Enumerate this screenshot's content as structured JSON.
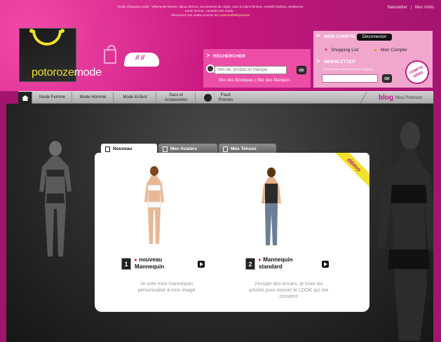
{
  "header": {
    "top_strip": [
      "Guide shopping mode : vêtements femme, bijoux femme, accessoires de mode, sacs à mains femme, conseils fashion, tendances",
      "mode femme, conseils look mode..."
    ],
    "top_strip_prefix": "Découvrez nos codes promos sur ",
    "top_strip_promo": "potorozeflashpromos",
    "links": [
      "Newsletter",
      "|",
      "Mes Visits"
    ],
    "logo_a": "potoroze",
    "logo_b": "mode"
  },
  "search": {
    "title": "RECHERCHER",
    "placeholder": "Mot clé, produit ou marque",
    "button": "OK",
    "link_boutiques": "Mur des Boutiques",
    "link_sep": "|",
    "link_marques": "Mur des Marques"
  },
  "account": {
    "title": "MON COMPTE",
    "logout": "Déconnexion",
    "shopping_list": "Shopping List",
    "my_account": "Mon Compte",
    "newsletter_title": "NEWSLETTER",
    "newsletter_text": "Recevez tous mes bons plans shopping !",
    "newsletter_ok": "OK",
    "badge": "COMPTE DÉMO"
  },
  "nav": {
    "items": [
      "Mode Femme",
      "Mode Homme",
      "Mode Enfant",
      "Sacs et Accessoires",
      "Flash Promos"
    ],
    "blog_label": "blog",
    "blog_user": "Miss Potoroze"
  },
  "card": {
    "tabs": [
      "Nouveau",
      "Mes Avatars",
      "Mes Tenues"
    ],
    "ribbon": "démo",
    "steps": [
      {
        "num": "1",
        "title": "nouveau Mannequin",
        "desc": "Je crée mon mannequin personnalisé à mon image"
      },
      {
        "num": "2",
        "title": "Mannequin standard",
        "desc": "J'essaie des tenues, je mixe les articles pour trouver le LOOK qui me convient"
      }
    ]
  },
  "colors": {
    "brand_pink": "#a3146f",
    "accent_yellow": "#f1e22b",
    "panel_pink": "#ec4ea6",
    "account_pink": "#f1a7cd"
  },
  "icons": [
    "home-icon",
    "search-icon",
    "bag-icon",
    "shoe-icon",
    "heart-icon",
    "user-icon",
    "newsletter-icon",
    "play-icon"
  ]
}
